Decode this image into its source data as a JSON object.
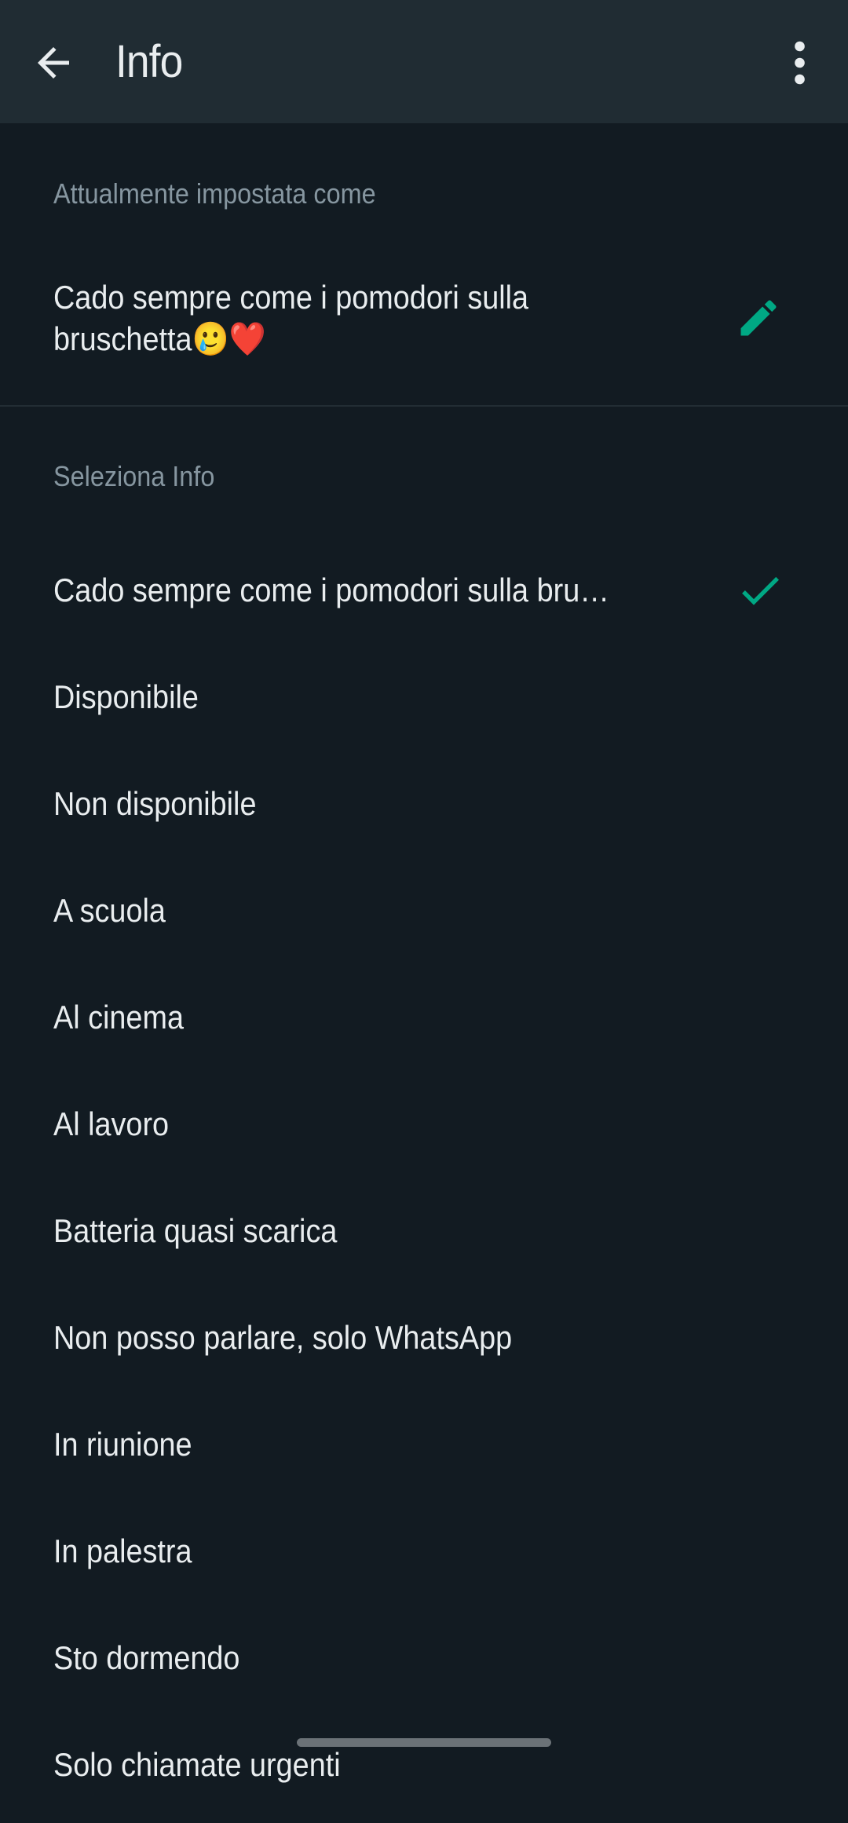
{
  "appbar": {
    "title": "Info",
    "back_icon": "arrow-left-icon",
    "menu_icon": "more-vertical-icon"
  },
  "current": {
    "section_label": "Attualmente impostata come",
    "status_text": "Cado sempre come i pomodori sulla bruschetta🥲❤️",
    "edit_icon": "pencil-icon"
  },
  "select": {
    "section_label": "Seleziona Info",
    "items": [
      {
        "label": "Cado sempre come i pomodori sulla bru…",
        "selected": true
      },
      {
        "label": "Disponibile",
        "selected": false
      },
      {
        "label": "Non disponibile",
        "selected": false
      },
      {
        "label": "A scuola",
        "selected": false
      },
      {
        "label": "Al cinema",
        "selected": false
      },
      {
        "label": "Al lavoro",
        "selected": false
      },
      {
        "label": "Batteria quasi scarica",
        "selected": false
      },
      {
        "label": "Non posso parlare, solo WhatsApp",
        "selected": false
      },
      {
        "label": "In riunione",
        "selected": false
      },
      {
        "label": "In palestra",
        "selected": false
      },
      {
        "label": "Sto dormendo",
        "selected": false
      },
      {
        "label": "Solo chiamate urgenti",
        "selected": false
      }
    ]
  },
  "colors": {
    "accent": "#00a884",
    "appbar_bg": "#202c33",
    "background": "#121b22",
    "secondary_text": "#8696a0",
    "primary_text": "#e9edef"
  }
}
